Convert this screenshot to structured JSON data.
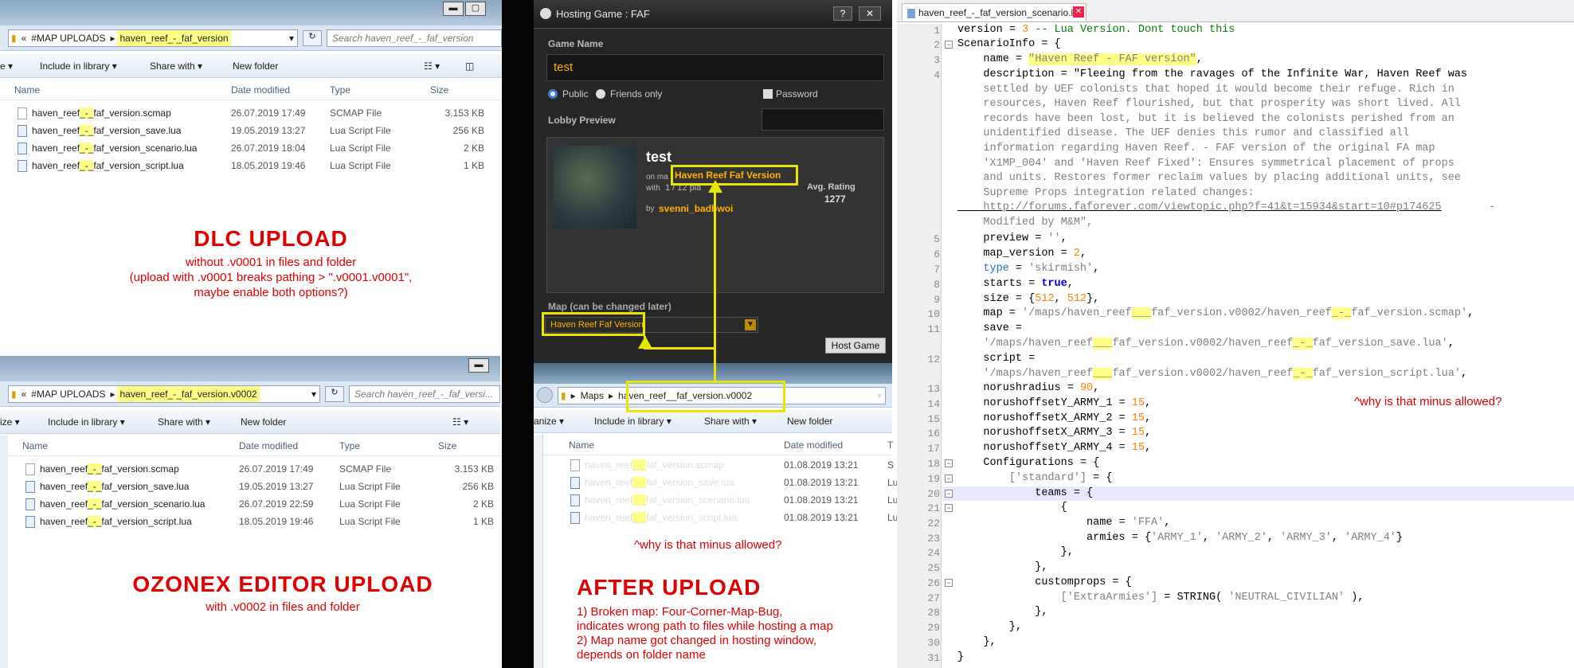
{
  "left_top": {
    "address_prefix": "«",
    "address_crumb1": "#MAP UPLOADS",
    "address_crumb2": "haven_reef_-_faf_version",
    "search": "Search haven_reef_-_faf_version",
    "toolbar": {
      "library": "Include in library ▾",
      "share": "Share with ▾",
      "newfolder": "New folder",
      "org": "e ▾"
    },
    "columns": {
      "name": "Name",
      "date": "Date modified",
      "type": "Type",
      "size": "Size"
    },
    "files": [
      {
        "n1": "haven_reef",
        "n2": "_-_",
        "n3": "faf_version.scmap",
        "date": "26.07.2019 17:49",
        "type": "SCMAP File",
        "size": "3.153 KB"
      },
      {
        "n1": "haven_reef",
        "n2": "_-_",
        "n3": "faf_version_save.lua",
        "date": "19.05.2019 13:27",
        "type": "Lua Script File",
        "size": "256 KB"
      },
      {
        "n1": "haven_reef",
        "n2": "_-_",
        "n3": "faf_version_scenario.lua",
        "date": "26.07.2019 18:04",
        "type": "Lua Script File",
        "size": "2 KB"
      },
      {
        "n1": "haven_reef",
        "n2": "_-_",
        "n3": "faf_version_script.lua",
        "date": "18.05.2019 19:46",
        "type": "Lua Script File",
        "size": "1 KB"
      }
    ]
  },
  "dlc": {
    "title": "DLC UPLOAD",
    "l1": "without .v0001 in files and folder",
    "l2": "(upload with .v0001 breaks pathing > \".v0001.v0001\",",
    "l3": "maybe enable both options?)"
  },
  "left_bottom": {
    "address_prefix": "«",
    "address_crumb1": "#MAP UPLOADS",
    "address_crumb2": "haven_reef_-_faf_version.v0002",
    "search": "Search haven_reef_-_faf_versi...",
    "toolbar": {
      "org": "ize ▾",
      "library": "Include in library ▾",
      "share": "Share with ▾",
      "newfolder": "New folder"
    },
    "columns": {
      "name": "Name",
      "date": "Date modified",
      "type": "Type",
      "size": "Size"
    },
    "files": [
      {
        "n1": "haven_reef",
        "n2": "_-_",
        "n3": "faf_version.scmap",
        "date": "26.07.2019 17:49",
        "type": "SCMAP File",
        "size": "3.153 KB"
      },
      {
        "n1": "haven_reef",
        "n2": "_-_",
        "n3": "faf_version_save.lua",
        "date": "19.05.2019 13:27",
        "type": "Lua Script File",
        "size": "256 KB"
      },
      {
        "n1": "haven_reef",
        "n2": "_-_",
        "n3": "faf_version_scenario.lua",
        "date": "26.07.2019 22:59",
        "type": "Lua Script File",
        "size": "2 KB"
      },
      {
        "n1": "haven_reef",
        "n2": "_-_",
        "n3": "faf_version_script.lua",
        "date": "18.05.2019 19:46",
        "type": "Lua Script File",
        "size": "1 KB"
      }
    ]
  },
  "ozonex": {
    "title": "OZONEX EDITOR UPLOAD",
    "l1": "with .v0002 in files and folder"
  },
  "hosting": {
    "title": "Hosting Game : FAF",
    "help": "?",
    "close": "✕",
    "game_name_label": "Game Name",
    "game_name_value": "test",
    "public": "Public",
    "friends": "Friends only",
    "password": "Password",
    "lobby_preview": "Lobby Preview",
    "preview_title": "test",
    "on_map": "on ma",
    "map_name": "Haven Reef Faf Version",
    "with": "with",
    "players": "1 / 12 pla",
    "by": "by",
    "author": "svenni_badbwoi",
    "avg_rating_label": "Avg. Rating",
    "avg_rating": "1277",
    "map_label": "Map (can be changed later)",
    "map_value": "Haven Reef Faf Version",
    "host_game": "Host Game"
  },
  "right_explorer": {
    "crumb1": "Maps",
    "crumb2": "haven_reef__faf_version.v0002",
    "toolbar": {
      "org": "anize ▾",
      "library": "Include in library ▾",
      "share": "Share with ▾",
      "newfolder": "New folder"
    },
    "columns": {
      "name": "Name",
      "date": "Date modified",
      "type": "T"
    },
    "files": [
      {
        "n1": "haven_reef",
        "n2": "_-_",
        "n3": "faf_version.scmap",
        "date": "01.08.2019 13:21",
        "type": "S"
      },
      {
        "n1": "haven_reef",
        "n2": "_-_",
        "n3": "faf_version_save.lua",
        "date": "01.08.2019 13:21",
        "type": "Lu"
      },
      {
        "n1": "haven_reef",
        "n2": "_-_",
        "n3": "faf_version_scenario.lua",
        "date": "01.08.2019 13:21",
        "type": "Lu"
      },
      {
        "n1": "haven_reef",
        "n2": "_-_",
        "n3": "faf_version_script.lua",
        "date": "01.08.2019 13:21",
        "type": "Lu"
      }
    ],
    "minus_note": "^why is that minus allowed?"
  },
  "after": {
    "title": "AFTER UPLOAD",
    "l1": "1) Broken map: Four-Corner-Map-Bug,",
    "l2": "indicates wrong path to files while hosting a map",
    "l3": "2) Map name got changed in hosting window,",
    "l4": "depends on folder name"
  },
  "editor": {
    "tab": "haven_reef_-_faf_version_scenario.lua",
    "tab_close": "✕",
    "minus_note": "^why is that minus allowed?",
    "line_numbers": [
      "1",
      "2",
      "3",
      "4",
      "5",
      "6",
      "7",
      "8",
      "9",
      "10",
      "11",
      "12",
      "13",
      "14",
      "15",
      "16",
      "17",
      "18",
      "19",
      "20",
      "21",
      "22",
      "23",
      "24",
      "25",
      "26",
      "27",
      "28",
      "29",
      "30",
      "31"
    ],
    "l1": [
      "version",
      " = ",
      "3",
      " -- Lua Version. Dont touch this"
    ],
    "l2": [
      "ScenarioInfo = {"
    ],
    "l3": [
      "    name = ",
      "\"Haven Reef - FAF version\"",
      ","
    ],
    "l4": [
      "    description = \"Fleeing from the ravages of the Infinite War, Haven Reef was",
      "    settled by UEF colonists that hoped it would become their refuge. Rich in",
      "    resources, Haven Reef flourished, but that prosperity was short lived. All",
      "    records have been lost, but it is believed the colonists perished from an",
      "    unidentified disease. The UEF denies this rumor and classified all",
      "    information regarding Haven Reef. - FAF version of the original FA map",
      "    'X1MP_004' and 'Haven Reef Fixed': Ensures symmetrical placement of props",
      "    and units. Restores former reclaim values by placing additional units, see",
      "    Supreme Props integration related changes:",
      "    http://forums.faforever.com/viewtopic.php?f=41&t=15934&start=10#p174625",
      " -",
      "    Modified by M&M\","
    ],
    "l5": [
      "    preview = ",
      "''",
      ","
    ],
    "l6": [
      "    map_version = ",
      "2",
      ","
    ],
    "l7": [
      "    ",
      "type",
      " = ",
      "'skirmish'",
      ","
    ],
    "l8": [
      "    starts = ",
      "true",
      ","
    ],
    "l9": [
      "    size = {",
      "512",
      ", ",
      "512",
      "},"
    ],
    "l10": [
      "    map = ",
      "'/maps/haven_reef",
      "___",
      "faf_version.v0002/haven_reef",
      "_-_",
      "faf_version.scmap'",
      ","
    ],
    "l11": [
      "    save =",
      "    '/maps/haven_reef",
      "___",
      "faf_version.v0002/haven_reef",
      "_-_",
      "faf_version_save.lua'",
      ","
    ],
    "l12": [
      "    script =",
      "    '/maps/haven_reef",
      "___",
      "faf_version.v0002/haven_reef",
      "_-_",
      "faf_version_script.lua'",
      ","
    ],
    "l13": [
      "    norushradius = ",
      "90",
      ","
    ],
    "l14": [
      "    norushoffsetY_ARMY_1 = ",
      "15",
      ","
    ],
    "l15": [
      "    norushoffsetX_ARMY_2 = ",
      "15",
      ","
    ],
    "l16": [
      "    norushoffsetX_ARMY_3 = ",
      "15",
      ","
    ],
    "l17": [
      "    norushoffsetY_ARMY_4 = ",
      "15",
      ","
    ],
    "l18": [
      "    Configurations = {"
    ],
    "l19": [
      "        ",
      "['standard']",
      " = {"
    ],
    "l20": [
      "            teams = {"
    ],
    "l21": [
      "                {"
    ],
    "l22": [
      "                    name = ",
      "'FFA'",
      ","
    ],
    "l23": [
      "                    armies = {",
      "'ARMY_1'",
      ", ",
      "'ARMY_2'",
      ", ",
      "'ARMY_3'",
      ", ",
      "'ARMY_4'",
      "}"
    ],
    "l24": [
      "                },"
    ],
    "l25": [
      "            },"
    ],
    "l26": [
      "            customprops = {"
    ],
    "l27": [
      "                ",
      "['ExtraArmies']",
      " = STRING( ",
      "'NEUTRAL_CIVILIAN'",
      " ),"
    ],
    "l28": [
      "            },"
    ],
    "l29": [
      "        },"
    ],
    "l30": [
      "    },"
    ],
    "l31": [
      "}"
    ]
  },
  "colors": {
    "highlight": "#e6e600",
    "annotation_red": "#e00000",
    "keyword": "#0000d0",
    "number": "#ff8000"
  }
}
